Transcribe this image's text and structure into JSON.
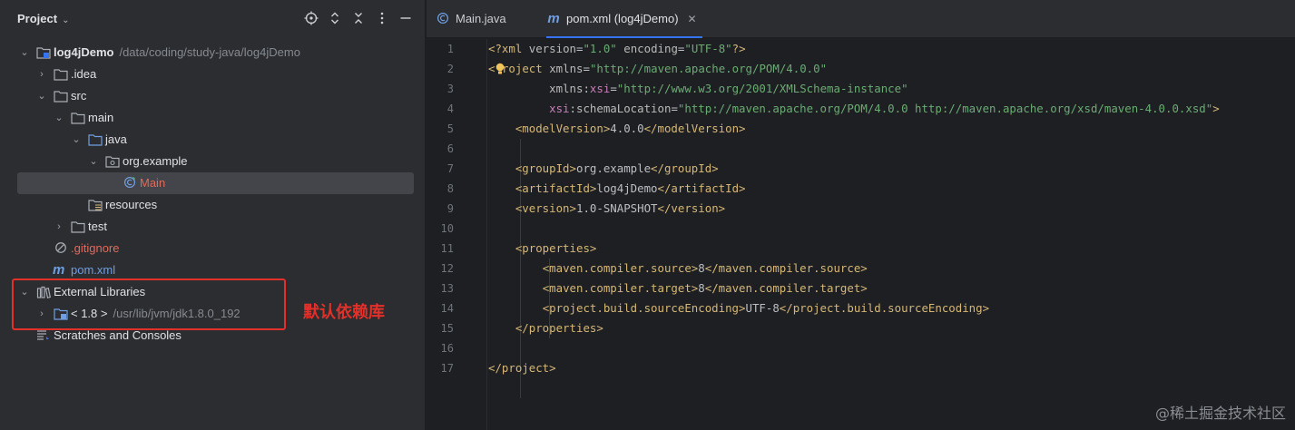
{
  "project_panel": {
    "title": "Project",
    "tree": [
      {
        "label": "log4jDemo",
        "path": "/data/coding/study-java/log4jDemo"
      },
      {
        "label": ".idea"
      },
      {
        "label": "src"
      },
      {
        "label": "main"
      },
      {
        "label": "java"
      },
      {
        "label": "org.example"
      },
      {
        "label": "Main"
      },
      {
        "label": "resources"
      },
      {
        "label": "test"
      },
      {
        "label": ".gitignore"
      },
      {
        "label": "pom.xml"
      },
      {
        "label": "External Libraries"
      },
      {
        "label": "< 1.8 >",
        "path": "/usr/lib/jvm/jdk1.8.0_192"
      },
      {
        "label": "Scratches and Consoles"
      }
    ]
  },
  "annotation": {
    "text": "默认依赖库",
    "color": "#e3302a"
  },
  "tabs": [
    {
      "label": "Main.java",
      "active": false
    },
    {
      "label": "pom.xml (log4jDemo)",
      "active": true
    }
  ],
  "editor": {
    "line_numbers": [
      "1",
      "2",
      "3",
      "4",
      "5",
      "6",
      "7",
      "8",
      "9",
      "10",
      "11",
      "12",
      "13",
      "14",
      "15",
      "16",
      "17"
    ]
  },
  "watermark": "@稀土掘金技术社区",
  "colors": {
    "accent": "#3574f0",
    "tag": "#d5b778",
    "string": "#6aab73",
    "namespace": "#c77dbb"
  }
}
